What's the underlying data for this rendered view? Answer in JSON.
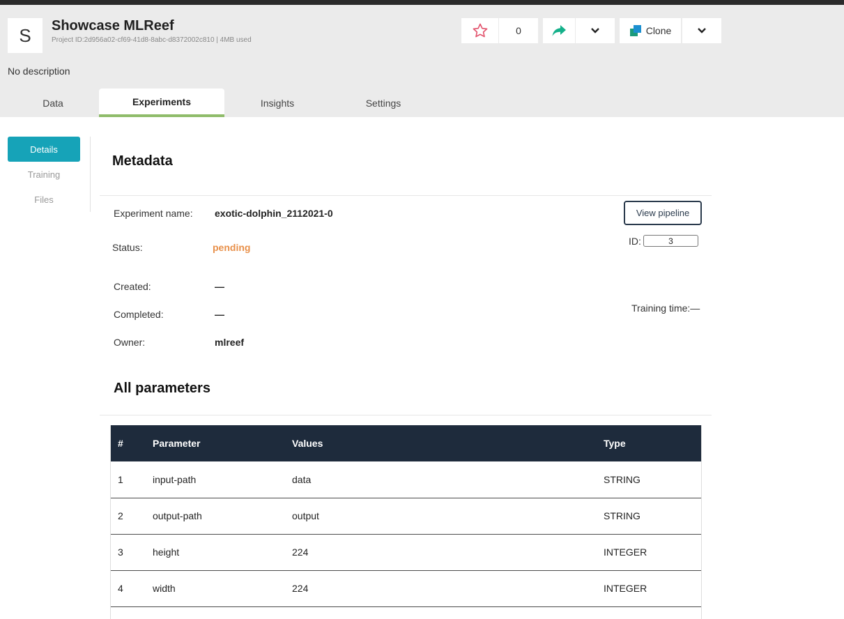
{
  "project": {
    "avatar_letter": "S",
    "title": "Showcase MLReef",
    "meta": "Project ID:2d956a02-cf69-41d8-8abc-d8372002c810 | 4MB used",
    "description": "No description"
  },
  "header_buttons": {
    "star_count": "0",
    "clone_label": "Clone"
  },
  "tabs": [
    {
      "label": "Data"
    },
    {
      "label": "Experiments"
    },
    {
      "label": "Insights"
    },
    {
      "label": "Settings"
    }
  ],
  "sidenav": [
    {
      "label": "Details"
    },
    {
      "label": "Training"
    },
    {
      "label": "Files"
    }
  ],
  "metadata": {
    "title": "Metadata",
    "experiment_name_label": "Experiment name:",
    "experiment_name": "exotic-dolphin_2112021-0",
    "status_label": "Status:",
    "status": "pending",
    "created_label": "Created:",
    "created": "—",
    "completed_label": "Completed:",
    "completed": "—",
    "owner_label": "Owner:",
    "owner": "mlreef",
    "view_pipeline": "View pipeline",
    "id_label": "ID:",
    "id_value": "3",
    "training_time": "Training time:—"
  },
  "parameters": {
    "title": "All parameters",
    "columns": [
      "#",
      "Parameter",
      "Values",
      "Type"
    ],
    "rows": [
      [
        "1",
        "input-path",
        "data",
        "STRING"
      ],
      [
        "2",
        "output-path",
        "output",
        "STRING"
      ],
      [
        "3",
        "height",
        "224",
        "INTEGER"
      ],
      [
        "4",
        "width",
        "224",
        "INTEGER"
      ]
    ]
  },
  "colors": {
    "accent": "#16a3b8",
    "pending": "#e8904a",
    "table_header": "#1e2b3c",
    "tab_underline": "#8fbc6a"
  }
}
